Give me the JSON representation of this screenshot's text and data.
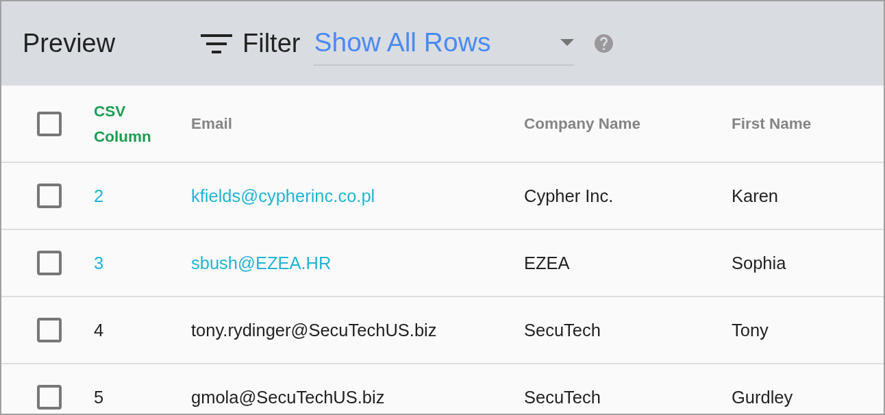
{
  "header": {
    "title": "Preview",
    "filter": {
      "label": "Filter",
      "value": "Show All Rows"
    }
  },
  "table": {
    "select_all": {
      "checked": false
    },
    "columns": [
      {
        "label": "CSV Column",
        "kind": "key"
      },
      {
        "label": "Email",
        "kind": "field"
      },
      {
        "label": "Company Name",
        "kind": "field"
      },
      {
        "label": "First Name",
        "kind": "field"
      }
    ],
    "rows": [
      {
        "checked": false,
        "highlighted": true,
        "cells": [
          "2",
          "kfields@cypherinc.co.pl",
          "Cypher Inc.",
          "Karen"
        ]
      },
      {
        "checked": false,
        "highlighted": true,
        "cells": [
          "3",
          "sbush@EZEA.HR",
          "EZEA",
          "Sophia"
        ]
      },
      {
        "checked": false,
        "highlighted": false,
        "cells": [
          "4",
          "tony.rydinger@SecuTechUS.biz",
          "SecuTech",
          "Tony"
        ]
      },
      {
        "checked": false,
        "highlighted": false,
        "cells": [
          "5",
          "gmola@SecuTechUS.biz",
          "SecuTech",
          "Gurdley"
        ]
      }
    ]
  }
}
